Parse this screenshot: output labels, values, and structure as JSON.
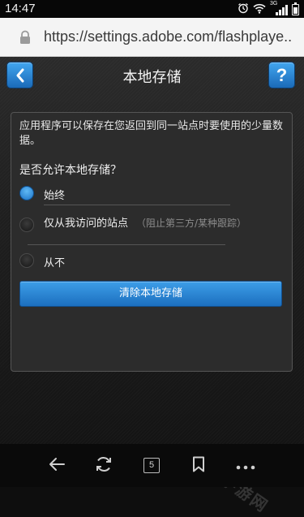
{
  "status_bar": {
    "time": "14:47",
    "network_label": "3G",
    "icons": [
      "alarm-icon",
      "wifi-icon",
      "signal-icon",
      "battery-icon"
    ]
  },
  "browser": {
    "url": "https://settings.adobe.com/flashplaye..",
    "lock_icon": "lock-icon"
  },
  "app": {
    "title": "本地存储",
    "back_icon": "chevron-left-icon",
    "help_label": "?",
    "description": "应用程序可以保存在您返回到同一站点时要使用的少量数据。",
    "question": "是否允许本地存储？",
    "options": [
      {
        "label": "始终",
        "sub": "",
        "selected": true
      },
      {
        "label": "仅从我访问的站点",
        "sub": "（阻止第三方/某种跟踪）",
        "selected": false
      },
      {
        "label": "从不",
        "sub": "",
        "selected": false
      }
    ],
    "clear_button": "清除本地存储",
    "accent": "#2f8ee0"
  },
  "watermark": "哈尼手游网",
  "bottom_nav": {
    "tab_count": "5",
    "icons": [
      "back-arrow-icon",
      "refresh-icon",
      "tabs-icon",
      "bookmark-icon",
      "more-icon"
    ]
  }
}
